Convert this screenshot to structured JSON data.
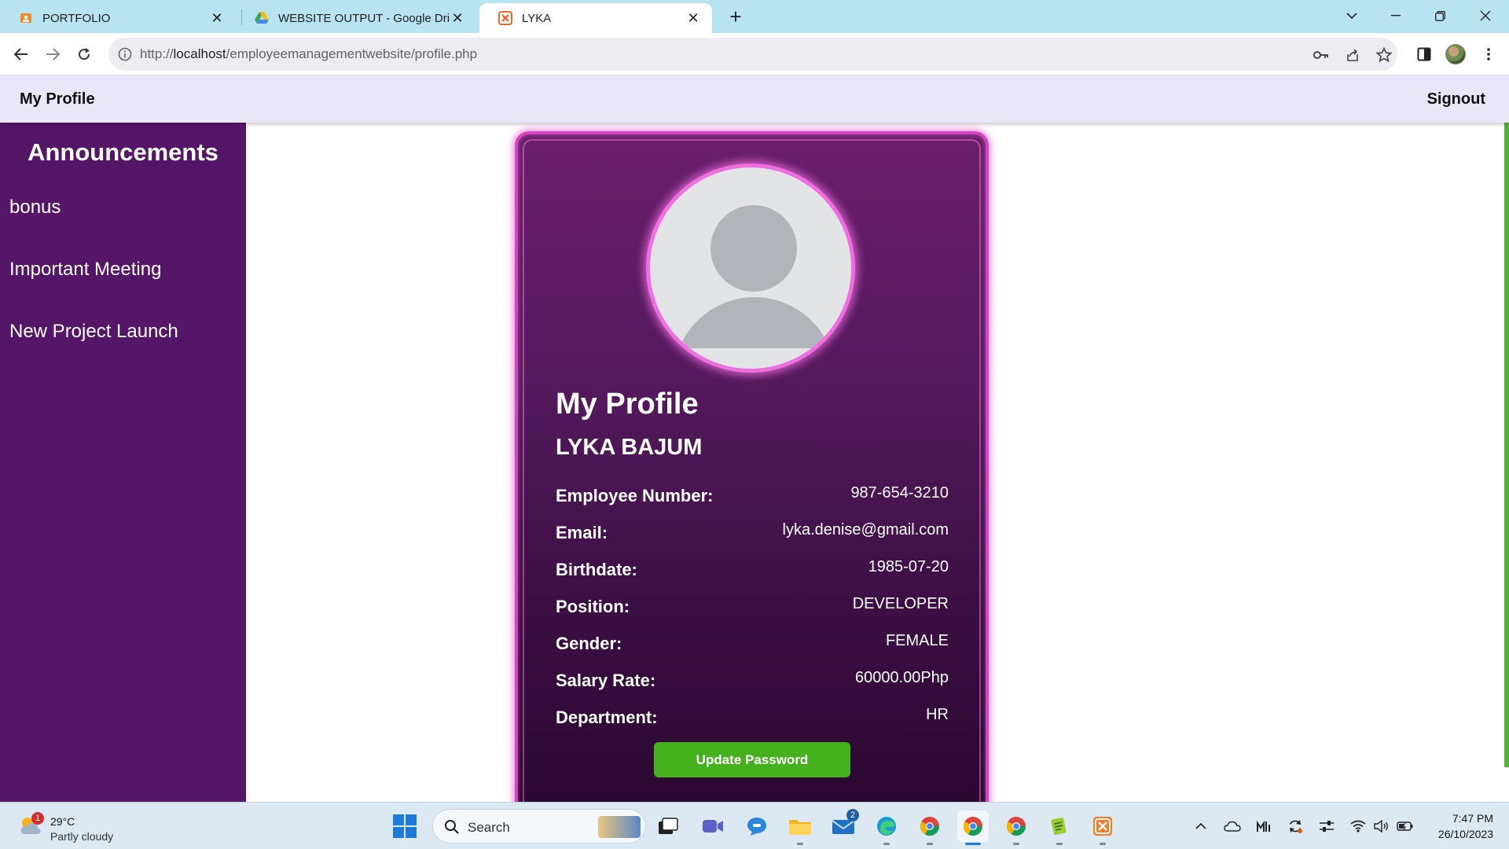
{
  "browser": {
    "tabs": [
      {
        "title": "PORTFOLIO",
        "icon": "portfolio-icon",
        "active": false
      },
      {
        "title": "WEBSITE OUTPUT - Google Drive",
        "icon": "google-drive-icon",
        "active": false
      },
      {
        "title": "LYKA",
        "icon": "xampp-icon",
        "active": true
      }
    ],
    "url_prefix": "http://",
    "url_host": "localhost",
    "url_path": "/employeemanagementwebsite/profile.php"
  },
  "page": {
    "nav": {
      "brand": "My Profile",
      "signout": "Signout"
    },
    "sidebar": {
      "title": "Announcements",
      "items": [
        "bonus",
        "Important Meeting",
        "New Project Launch"
      ]
    },
    "profile": {
      "heading": "My Profile",
      "name": "LYKA BAJUM",
      "fields": [
        {
          "label": "Employee Number:",
          "value": "987-654-3210"
        },
        {
          "label": "Email:",
          "value": "lyka.denise@gmail.com"
        },
        {
          "label": "Birthdate:",
          "value": "1985-07-20"
        },
        {
          "label": "Position:",
          "value": "DEVELOPER"
        },
        {
          "label": "Gender:",
          "value": "FEMALE"
        },
        {
          "label": "Salary Rate:",
          "value": "60000.00Php"
        },
        {
          "label": "Department:",
          "value": "HR"
        }
      ],
      "button": "Update Password"
    },
    "colors": {
      "sidebar": "#561668",
      "nav": "#e8e6f8",
      "card_border": "#d842c0",
      "button": "#44b11d"
    }
  },
  "taskbar": {
    "weather": {
      "temp": "29°C",
      "condition": "Partly cloudy",
      "badge": "1"
    },
    "search_label": "Search",
    "mail_badge": "2",
    "time": "7:47 PM",
    "date": "26/10/2023"
  }
}
